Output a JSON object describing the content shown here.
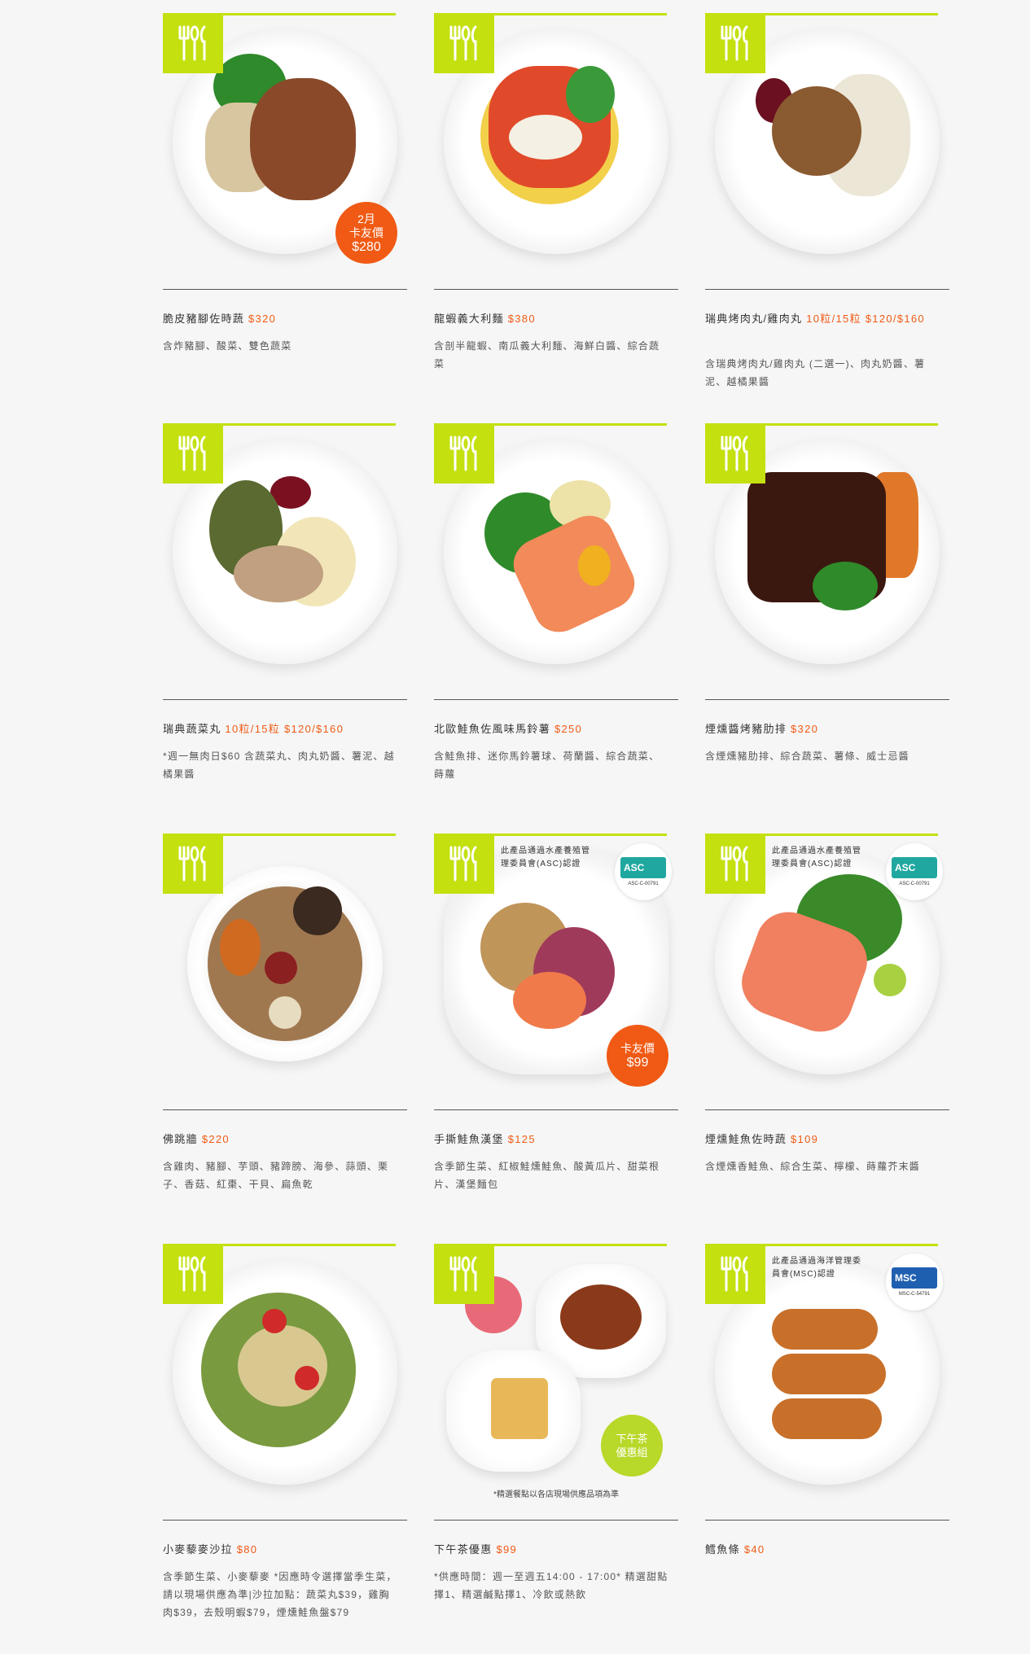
{
  "colors": {
    "accent": "#c4e00f",
    "price": "#f05a14",
    "text": "#333333"
  },
  "icons": {
    "badge": "fork-spoon-knife-icon"
  },
  "items": [
    {
      "name": "脆皮豬腳佐時蔬",
      "price": "$320",
      "desc": "含炸豬腳、酸菜、雙色蔬菜",
      "badge_line1": "2月",
      "badge_line2": "卡友價",
      "badge_line3": "$280"
    },
    {
      "name": "龍蝦義大利麵",
      "price": "$380",
      "desc": "含剖半龍蝦、南瓜義大利麵、海鮮白醬、綜合蔬菜"
    },
    {
      "name": "瑞典烤肉丸/雞肉丸 ",
      "price": "10粒/15粒 $120/$160",
      "desc": "含瑞典烤肉丸/雞肉丸 (二選一)、肉丸奶醬、薯泥、越橘果醬"
    },
    {
      "name": "瑞典蔬菜丸 ",
      "price": "10粒/15粒 $120/$160",
      "desc": "*週一無肉日$60 含蔬菜丸、肉丸奶醬、薯泥、越橘果醬"
    },
    {
      "name": "北歐鮭魚佐風味馬鈴薯",
      "price": "$250",
      "desc": "含鮭魚排、迷你馬鈴薯球、荷蘭醬、綜合蔬菜、蒔蘿"
    },
    {
      "name": "煙燻醬烤豬肋排",
      "price": "$320",
      "desc": "含煙燻豬肋排、綜合蔬菜、薯條、威士忌醬"
    },
    {
      "name": "佛跳牆",
      "price": "$220",
      "desc": "含雞肉、豬腳、芋頭、豬蹄膀、海參、蒜頭、栗子、香菇、紅棗、干貝、扁魚乾"
    },
    {
      "name": "手撕鮭魚漢堡",
      "price": "$125",
      "desc": "含季節生菜、紅椒鮭燻鮭魚、酸黃瓜片、甜菜根片、漢堡麵包",
      "cert": "此產品通過水產養殖管理委員會(ASC)認證",
      "cert_logo": "asc",
      "cert_code": "ASC-C-00791",
      "badge_line1": "卡友價",
      "badge_line2": "$99"
    },
    {
      "name": "煙燻鮭魚佐時蔬",
      "price": "$109",
      "desc": "含煙燻香鮭魚、綜合生菜、檸檬、蒔蘿芥末醬",
      "cert": "此產品通過水產養殖管理委員會(ASC)認證",
      "cert_logo": "asc",
      "cert_code": "ASC-C-00791"
    },
    {
      "name": "小麥藜麥沙拉",
      "price": "$80",
      "desc": "含季節生菜、小麥藜麥 *因應時令選擇當季生菜，請以現場供應為準|沙拉加點：蔬菜丸$39，雞胸肉$39，去殼明蝦$79，煙燻鮭魚盤$79"
    },
    {
      "name": "下午茶優惠",
      "price": "$99",
      "desc": "*供應時間：週一至週五14:00 - 17:00* 精選甜點擇1、精選鹹點擇1、冷飲或熱飲",
      "badge_line1": "下午茶",
      "badge_line2": "優惠組",
      "footnote": "*精選餐點以各店現場供應品項為準"
    },
    {
      "name": "鱈魚條",
      "price": "$40",
      "desc": "",
      "cert": "此產品通過海洋管理委員會(MSC)認證",
      "cert_logo": "msc",
      "cert_code": "MSC-C-54791"
    }
  ]
}
